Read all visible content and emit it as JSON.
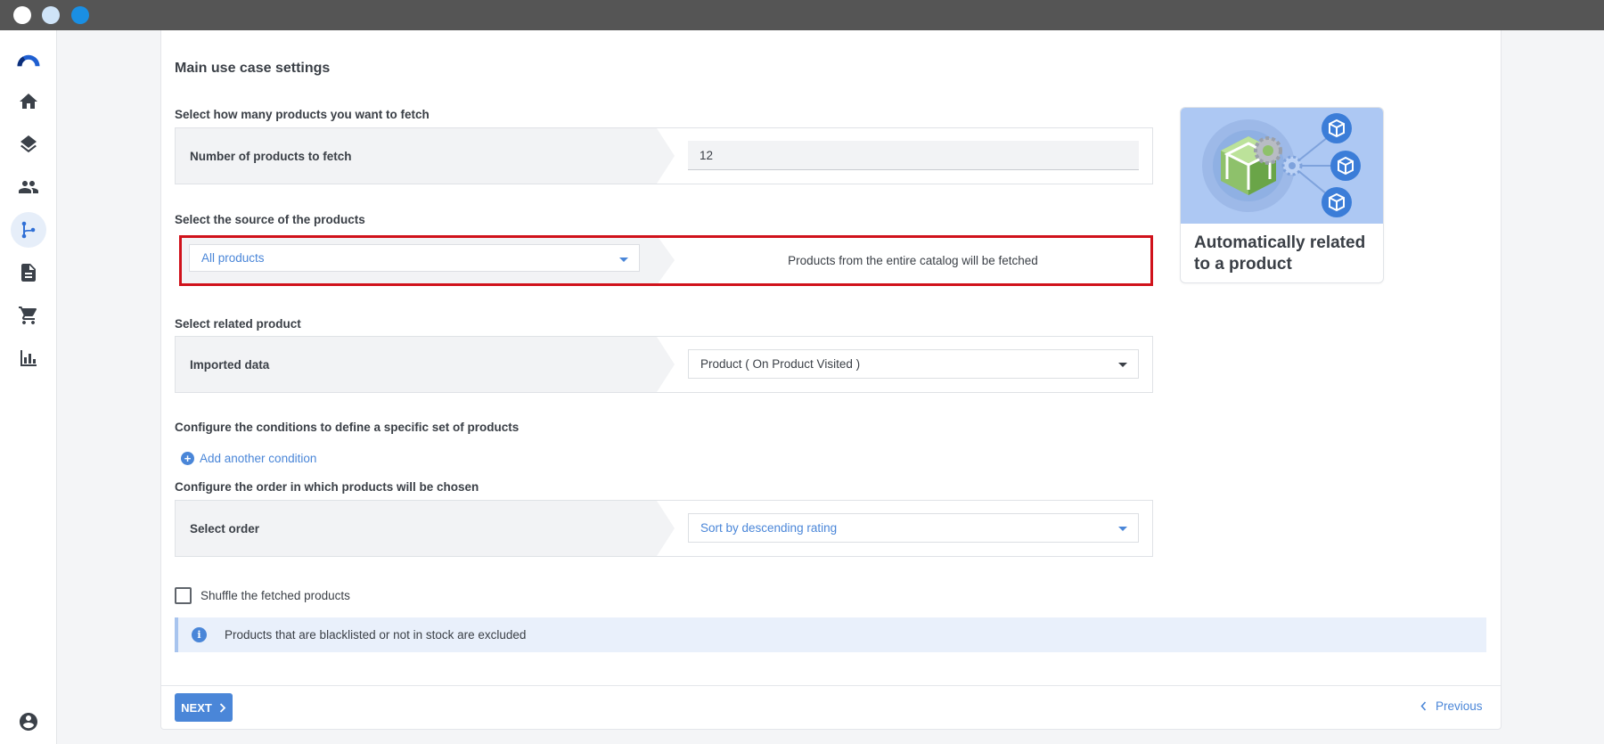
{
  "window": {
    "controls": [
      "close",
      "minimize",
      "maximize"
    ]
  },
  "sidebar": {
    "items": [
      {
        "name": "logo",
        "icon": "brand-logo-icon"
      },
      {
        "name": "home",
        "icon": "home-icon"
      },
      {
        "name": "layers",
        "icon": "layers-icon"
      },
      {
        "name": "people",
        "icon": "people-icon"
      },
      {
        "name": "flow",
        "icon": "branch-icon",
        "active": true
      },
      {
        "name": "documents",
        "icon": "document-icon"
      },
      {
        "name": "cart",
        "icon": "cart-icon"
      },
      {
        "name": "analytics",
        "icon": "bar-chart-icon"
      },
      {
        "name": "account",
        "icon": "account-icon"
      }
    ]
  },
  "main": {
    "heading": "Main use case settings",
    "fetch": {
      "label": "Select how many products you want to fetch",
      "row_label": "Number of products to fetch",
      "value": "12"
    },
    "source": {
      "label": "Select the source of the products",
      "selected": "All products",
      "description": "Products from the entire catalog will be fetched"
    },
    "related": {
      "label": "Select related product",
      "row_label": "Imported data",
      "selected": "Product ( On Product Visited )"
    },
    "conditions": {
      "label": "Configure the conditions to define a specific set of products",
      "add_label": "Add another condition"
    },
    "order": {
      "label": "Configure the order in which products will be chosen",
      "row_label": "Select order",
      "selected": "Sort by descending rating"
    },
    "shuffle": {
      "label": "Shuffle the fetched products",
      "checked": false
    },
    "info": {
      "text": "Products that are blacklisted or not in stock are excluded"
    }
  },
  "promo": {
    "title": "Automatically related to a product"
  },
  "footer": {
    "next_label": "NEXT",
    "previous_label": "Previous"
  },
  "colors": {
    "accent": "#4a86d8",
    "highlight": "#d0121b",
    "titlebar": "#555555"
  }
}
